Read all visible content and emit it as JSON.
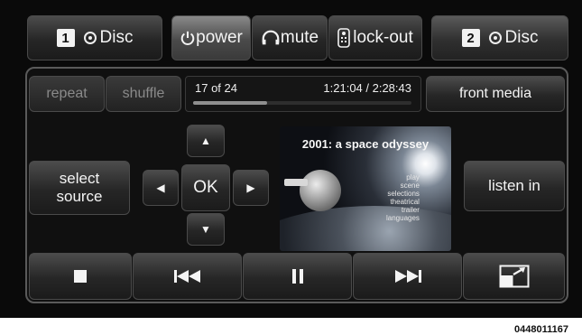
{
  "top_bar": {
    "source1": {
      "number": "1",
      "label": "Disc"
    },
    "power": {
      "label": "power"
    },
    "mute": {
      "label": "mute"
    },
    "lockout": {
      "label": "lock-out"
    },
    "source2": {
      "number": "2",
      "label": "Disc"
    }
  },
  "controls": {
    "repeat": "repeat",
    "shuffle": "shuffle",
    "front_media": "front media",
    "select_source_line1": "select",
    "select_source_line2": "source",
    "listen_in": "listen in",
    "ok": "OK"
  },
  "progress": {
    "chapter": "17 of 24",
    "time": "1:21:04 / 2:28:43",
    "fraction": 0.34
  },
  "video": {
    "title": "2001: a space odyssey",
    "menu_items": [
      "play",
      "scene",
      "selections",
      "theatrical",
      "trailer",
      "languages"
    ]
  },
  "image_code": "0448011167",
  "icons": {
    "disc": "disc-icon",
    "power": "power-icon",
    "mute": "headphones-icon",
    "lockout": "remote-icon",
    "stop": "stop-icon",
    "prev": "previous-icon",
    "pause": "pause-icon",
    "next": "next-icon",
    "expand": "expand-icon"
  }
}
